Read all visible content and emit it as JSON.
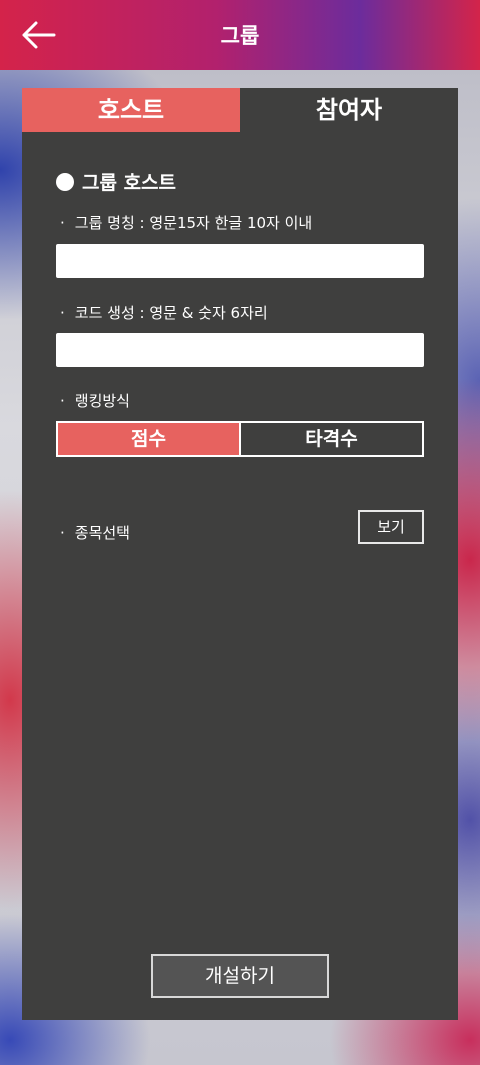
{
  "header": {
    "title": "그룹",
    "back_icon": "arrow-left-icon"
  },
  "tabs": [
    {
      "label": "호스트",
      "active": true
    },
    {
      "label": "참여자",
      "active": false
    }
  ],
  "host_form": {
    "section_title": "그룹 호스트",
    "bullet": "·",
    "group_name_label": "그룹 명칭 : 영문15자 한글 10자 이내",
    "group_name_value": "",
    "code_label": "코드 생성 : 영문 & 숫자 6자리",
    "code_value": "",
    "ranking_label": "랭킹방식",
    "ranking_options": [
      "점수",
      "타격수"
    ],
    "ranking_selected": "점수",
    "event_label": "종목선택",
    "view_button": "보기",
    "submit_button": "개설하기"
  },
  "colors": {
    "accent": "#e7625f",
    "panel": "#3f3f3e",
    "header_gradient_start": "#d4234a",
    "header_gradient_mid": "#6c2c9c"
  }
}
